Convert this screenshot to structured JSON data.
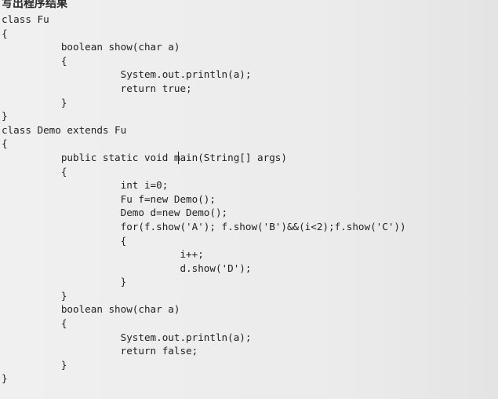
{
  "title": "写出程序结果",
  "code_lines": [
    "class Fu",
    "{",
    "          boolean show(char a)",
    "          {",
    "                    System.out.println(a);",
    "                    return true;",
    "          }",
    "}",
    "class Demo extends Fu",
    "{",
    "          public static void main(String[] args)",
    "          {",
    "                    int i=0;",
    "                    Fu f=new Demo();",
    "                    Demo d=new Demo();",
    "                    for(f.show('A'); f.show('B')&&(i<2);f.show('C'))",
    "                    {",
    "                              i++;",
    "                              d.show('D');",
    "                    }",
    "          }",
    "          boolean show(char a)",
    "          {",
    "                    System.out.println(a);",
    "                    return false;",
    "          }",
    "}"
  ]
}
